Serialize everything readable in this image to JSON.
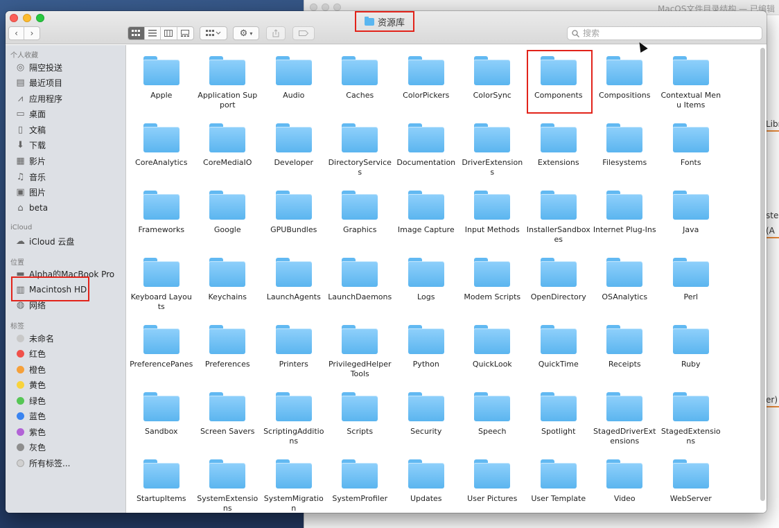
{
  "background_window": {
    "title": "MacOS文件目录结构 — 已编辑",
    "snippets": [
      "Libra",
      "ster",
      "(A",
      "er)"
    ]
  },
  "window": {
    "title": "资源库"
  },
  "toolbar": {
    "back": "‹",
    "forward": "›",
    "search_placeholder": "搜索"
  },
  "sidebar": {
    "favorites_title": "个人收藏",
    "favorites": [
      {
        "label": "隔空投送",
        "icon": "airdrop-icon"
      },
      {
        "label": "最近项目",
        "icon": "recent-icon"
      },
      {
        "label": "应用程序",
        "icon": "applications-icon"
      },
      {
        "label": "桌面",
        "icon": "desktop-icon"
      },
      {
        "label": "文稿",
        "icon": "documents-icon"
      },
      {
        "label": "下载",
        "icon": "downloads-icon"
      },
      {
        "label": "影片",
        "icon": "movies-icon"
      },
      {
        "label": "音乐",
        "icon": "music-icon"
      },
      {
        "label": "图片",
        "icon": "pictures-icon"
      },
      {
        "label": "beta",
        "icon": "home-icon"
      }
    ],
    "icloud_title": "iCloud",
    "icloud": [
      {
        "label": "iCloud 云盘",
        "icon": "cloud-icon"
      }
    ],
    "locations_title": "位置",
    "locations": [
      {
        "label": "Alpha的MacBook Pro",
        "icon": "laptop-icon"
      },
      {
        "label": "Macintosh HD",
        "icon": "harddisk-icon"
      },
      {
        "label": "网络",
        "icon": "network-icon"
      }
    ],
    "tags_title": "标签",
    "tags": [
      {
        "label": "未命名",
        "color": "#c8c8c8"
      },
      {
        "label": "红色",
        "color": "#f0514a"
      },
      {
        "label": "橙色",
        "color": "#f5a03a"
      },
      {
        "label": "黄色",
        "color": "#f8d33c"
      },
      {
        "label": "绿色",
        "color": "#56c655"
      },
      {
        "label": "蓝色",
        "color": "#3a84f0"
      },
      {
        "label": "紫色",
        "color": "#b263d6"
      },
      {
        "label": "灰色",
        "color": "#8e8e8e"
      },
      {
        "label": "所有标签...",
        "color": "#d0d0d0"
      }
    ]
  },
  "folders": [
    "Apple",
    "Application Support",
    "Audio",
    "Caches",
    "ColorPickers",
    "ColorSync",
    "Components",
    "Compositions",
    "Contextual Menu Items",
    "CoreAnalytics",
    "CoreMediaIO",
    "Developer",
    "DirectoryServices",
    "Documentation",
    "DriverExtensions",
    "Extensions",
    "Filesystems",
    "Fonts",
    "Frameworks",
    "Google",
    "GPUBundles",
    "Graphics",
    "Image Capture",
    "Input Methods",
    "InstallerSandboxes",
    "Internet Plug-Ins",
    "Java",
    "Keyboard Layouts",
    "Keychains",
    "LaunchAgents",
    "LaunchDaemons",
    "Logs",
    "Modem Scripts",
    "OpenDirectory",
    "OSAnalytics",
    "Perl",
    "PreferencePanes",
    "Preferences",
    "Printers",
    "PrivilegedHelperTools",
    "Python",
    "QuickLook",
    "QuickTime",
    "Receipts",
    "Ruby",
    "Sandbox",
    "Screen Savers",
    "ScriptingAdditions",
    "Scripts",
    "Security",
    "Speech",
    "Spotlight",
    "StagedDriverExtensions",
    "StagedExtensions",
    "StartupItems",
    "SystemExtensions",
    "SystemMigration",
    "SystemProfiler",
    "Updates",
    "User Pictures",
    "User Template",
    "Video",
    "WebServer"
  ],
  "highlighted_folder": "Components"
}
